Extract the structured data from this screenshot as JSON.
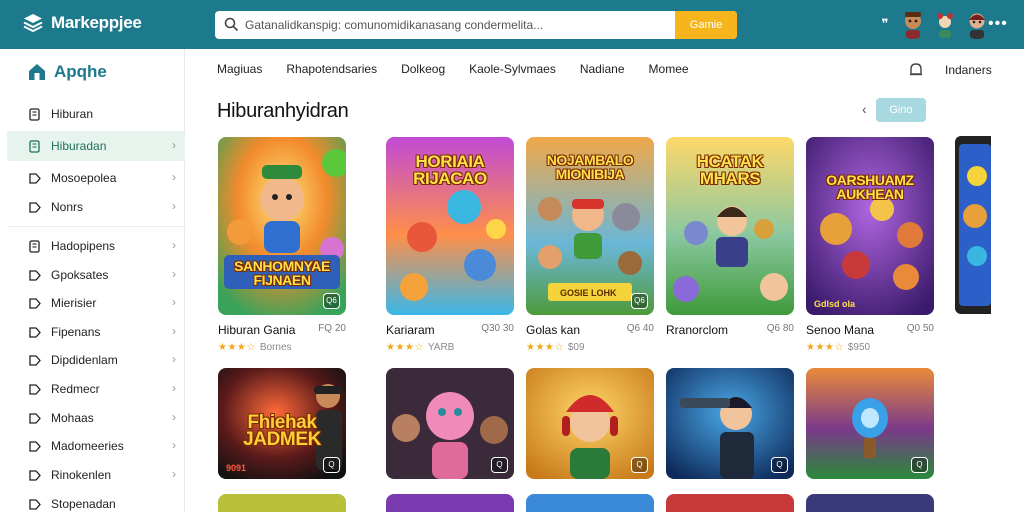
{
  "app": {
    "title": "Markeppjee"
  },
  "search": {
    "placeholder": "Gatanalidkanspig: comunomidikanasang condermelita...",
    "button": "Gamie"
  },
  "sidebar": {
    "brand": "Apqhe",
    "items": [
      {
        "label": "Hiburan",
        "icon": "bookmark-icon",
        "chevron": false
      },
      {
        "label": "Hiburadan",
        "icon": "bookmark-icon",
        "chevron": true,
        "active": true
      },
      {
        "label": "Mosoepolea",
        "icon": "tag-icon",
        "chevron": true
      },
      {
        "label": "Nonrs",
        "icon": "tag-icon",
        "chevron": true
      },
      {
        "label": "Hadopipens",
        "icon": "bookmark-icon",
        "chevron": true
      },
      {
        "label": "Gpoksates",
        "icon": "tag-icon",
        "chevron": true
      },
      {
        "label": "Mierisier",
        "icon": "tag-icon",
        "chevron": true
      },
      {
        "label": "Fipenans",
        "icon": "tag-icon",
        "chevron": true
      },
      {
        "label": "Dipdidenlam",
        "icon": "tag-icon",
        "chevron": true
      },
      {
        "label": "Redmecr",
        "icon": "tag-icon",
        "chevron": true
      },
      {
        "label": "Mohaas",
        "icon": "tag-icon",
        "chevron": true
      },
      {
        "label": "Madomeeries",
        "icon": "tag-icon",
        "chevron": true
      },
      {
        "label": "Rinokenlen",
        "icon": "tag-icon",
        "chevron": true
      },
      {
        "label": "Stopenadan",
        "icon": "tag-icon",
        "chevron": false
      }
    ]
  },
  "nav": {
    "categories": [
      "Magiuas",
      "Rhapotendsaries",
      "Dolkeog",
      "Kaole-Sylvmaes",
      "Nadiane",
      "Momee"
    ],
    "right_label": "Indaners"
  },
  "main": {
    "heading": "Hiburanhyidran",
    "pill_button": "Gino"
  },
  "cards": [
    {
      "name": "Hiburan Gania",
      "price": "FQ 20",
      "reviews": "Bornes",
      "thumb_title": "SANHOMNYAE FIJNAEN",
      "badge": "Q6"
    },
    {
      "name": "Kariaram",
      "price": "Q30 30",
      "reviews": "YARB",
      "thumb_title": "HORIAIA RIJACAO",
      "badge": ""
    },
    {
      "name": "Golas kan",
      "price": "Q6 40",
      "reviews": "$09",
      "thumb_title": "NOJAMBALO MIONIBIJA",
      "badge": "Q6",
      "badge_text": "GOSIE LOHK"
    },
    {
      "name": "Rranorclom",
      "price": "Q6 80",
      "reviews": "",
      "thumb_title": "HCATAK MHARS",
      "badge": ""
    },
    {
      "name": "Senoo Mana",
      "price": "Q0 50",
      "reviews": "$950",
      "thumb_title": "OARSHUAMZ AUKHEAN",
      "badge": "",
      "badge_text": "Gdlsd ola"
    }
  ],
  "cards_row2": [
    {
      "thumb_title": "Fhiehak JADMEK",
      "badge": "Q",
      "badge_text": "9091"
    },
    {
      "thumb_title": "",
      "badge": "Q"
    },
    {
      "thumb_title": "",
      "badge": "Q"
    },
    {
      "thumb_title": "",
      "badge": "Q"
    },
    {
      "thumb_title": "",
      "badge": "Q"
    }
  ],
  "colors": {
    "header": "#1d7a8c",
    "accent": "#f6b51d",
    "active_item_bg": "#e7f4ee",
    "brand_text": "#1d7a8c"
  }
}
